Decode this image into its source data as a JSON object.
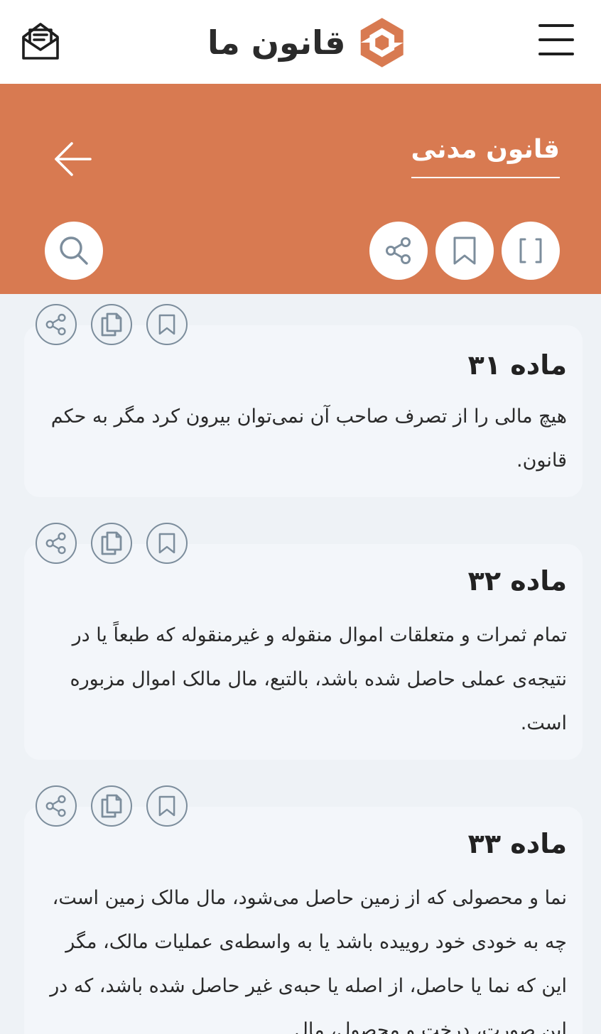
{
  "app": {
    "brand_name": "قانون ما",
    "icons": {
      "mail": "envelope-open-icon",
      "menu": "hamburger-menu-icon",
      "logo": "hexagon-logo-icon"
    },
    "colors": {
      "accent": "#d87a51",
      "background": "#eef2f6",
      "card": "#f3f6fa",
      "icon_stroke": "#7c8d9c"
    }
  },
  "header": {
    "book_title": "قانون مدنی",
    "icons": {
      "back": "arrow-left-icon",
      "search": "search-icon",
      "share": "share-icon",
      "bookmark": "bookmark-icon",
      "expand": "brackets-expand-icon"
    }
  },
  "articles": [
    {
      "title": "ماده ۳۱",
      "body": "هیچ مالی را از تصرف صاحب آن نمی‌توان بیرون کرد مگر به حکم قانون."
    },
    {
      "title": "ماده ۳۲",
      "body": "تمام ثمرات و متعلقات اموال منقوله و غیرمنقوله که طبعاً یا در نتیجه‌ی عملی حاصل شده باشد، بالتبع، مال مالک اموال مزبوره است."
    },
    {
      "title": "ماده ۳۳",
      "body": "نما و محصولی که از زمین حاصل می‌شود، مال مالک زمین است، چه به خودی خود روییده باشد یا به واسطه‌ی عملیات مالک، مگر این که نما یا حاصل، از اصله یا حبه‌ی غیر حاصل شده باشد، که در این صورت، درخت و محصول، مال"
    }
  ],
  "article_actions": {
    "share": "share-icon",
    "copy": "copy-icon",
    "bookmark": "bookmark-icon"
  }
}
